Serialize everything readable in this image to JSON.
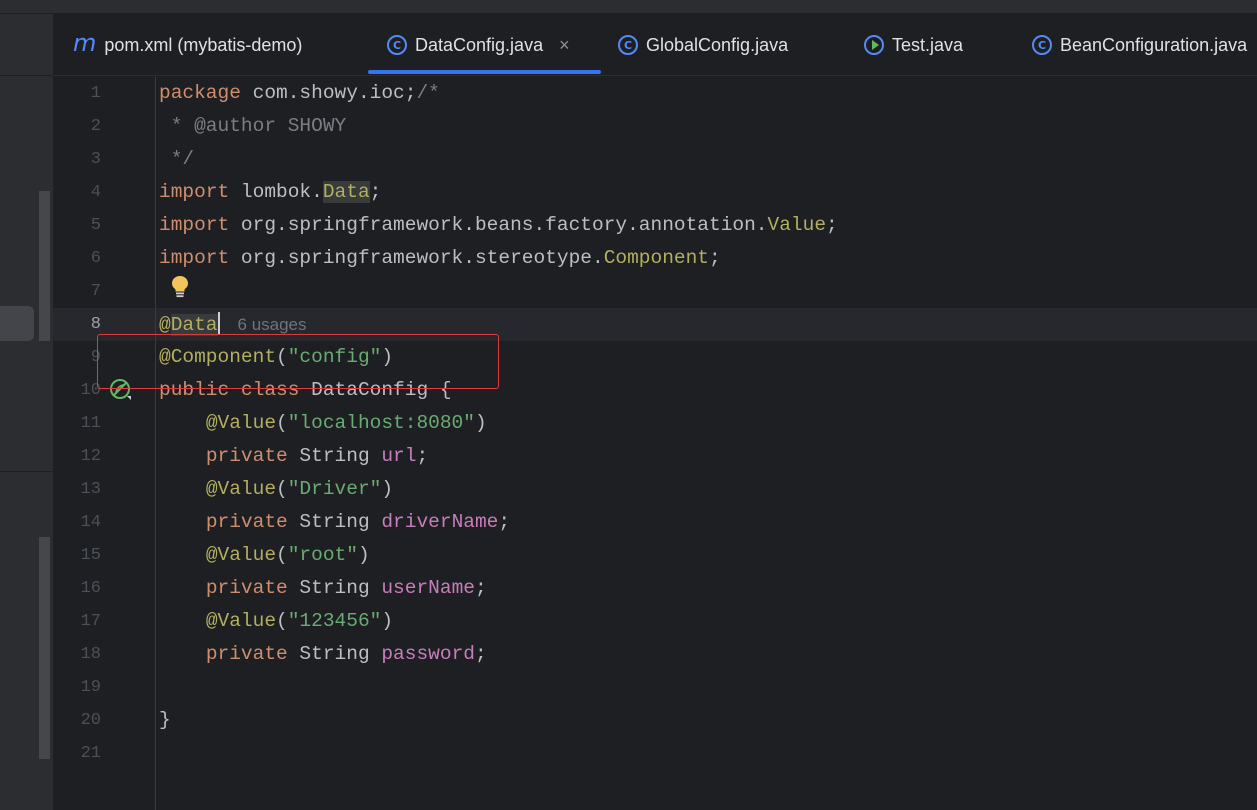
{
  "tabs": [
    {
      "label": "pom.xml (mybatis-demo)",
      "icon": "maven-icon"
    },
    {
      "label": "DataConfig.java",
      "icon": "class-icon",
      "active": true,
      "close": "×"
    },
    {
      "label": "GlobalConfig.java",
      "icon": "class-icon"
    },
    {
      "label": "Test.java",
      "icon": "runnable-class-icon"
    },
    {
      "label": "BeanConfiguration.java",
      "icon": "class-icon"
    }
  ],
  "editor": {
    "current_line": 8,
    "line_numbers": [
      "1",
      "2",
      "3",
      "4",
      "5",
      "6",
      "7",
      "8",
      "9",
      "10",
      "11",
      "12",
      "13",
      "14",
      "15",
      "16",
      "17",
      "18",
      "19",
      "20",
      "21"
    ],
    "usages_hint": "6 usages",
    "code": {
      "l1_kw": "package",
      "l1_rest": " com.showy.ioc;",
      "l1_cm": "/*",
      "l2_cm": " * @author SHOWY",
      "l3_cm": " */",
      "l4_kw": "import",
      "l4_rest": " lombok.",
      "l4_cls": "Data",
      "l4_end": ";",
      "l5_kw": "import",
      "l5_rest": " org.springframework.beans.factory.annotation.",
      "l5_cls": "Value",
      "l5_end": ";",
      "l6_kw": "import",
      "l6_rest": " org.springframework.stereotype.",
      "l6_cls": "Component",
      "l6_end": ";",
      "l8_at": "@",
      "l8_ann": "Data",
      "l9_ann": "@Component",
      "l9_p1": "(",
      "l9_str": "\"config\"",
      "l9_p2": ")",
      "l10_kw": "public class",
      "l10_rest": " DataConfig {",
      "l11_ann": "@Value",
      "l11_p1": "(",
      "l11_str": "\"localhost:8080\"",
      "l11_p2": ")",
      "l12_kw": "private",
      "l12_type": " String ",
      "l12_fld": "url",
      "l12_end": ";",
      "l13_ann": "@Value",
      "l13_p1": "(",
      "l13_str": "\"Driver\"",
      "l13_p2": ")",
      "l14_kw": "private",
      "l14_type": " String ",
      "l14_fld": "driverName",
      "l14_end": ";",
      "l15_ann": "@Value",
      "l15_p1": "(",
      "l15_str": "\"root\"",
      "l15_p2": ")",
      "l16_kw": "private",
      "l16_type": " String ",
      "l16_fld": "userName",
      "l16_end": ";",
      "l17_ann": "@Value",
      "l17_p1": "(",
      "l17_str": "\"123456\"",
      "l17_p2": ")",
      "l18_kw": "private",
      "l18_type": " String ",
      "l18_fld": "password",
      "l18_end": ";",
      "l20": "}"
    }
  },
  "colors": {
    "background": "#1e1f22",
    "keyword": "#cf8e6d",
    "annotation": "#b3ae60",
    "string": "#6aab73",
    "field": "#c77dbb",
    "accent": "#3574f0",
    "highlight_box": "#e0393e"
  }
}
